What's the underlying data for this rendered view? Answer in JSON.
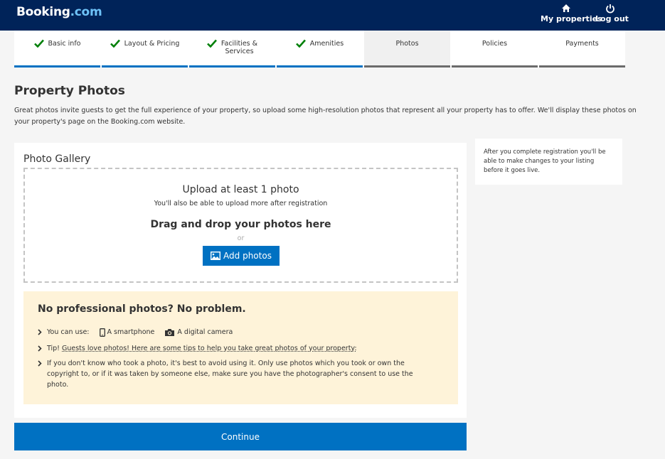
{
  "header": {
    "logo_main": "Booking",
    "logo_suffix": ".com",
    "my_properties": "My properties",
    "log_out": "Log out"
  },
  "steps": [
    {
      "label": "Basic info",
      "done": true
    },
    {
      "label": "Layout & Pricing",
      "done": true
    },
    {
      "label": "Facilities &",
      "label2": "Services",
      "done": true
    },
    {
      "label": "Amenities",
      "done": true
    },
    {
      "label": "Photos",
      "active": true
    },
    {
      "label": "Policies"
    },
    {
      "label": "Payments"
    }
  ],
  "page": {
    "title": "Property Photos",
    "intro": "Great photos invite guests to get the full experience of your property, so upload some high-resolution photos that represent all your property has to offer. We'll display these photos on your property's page on the Booking.com website."
  },
  "gallery": {
    "title": "Photo Gallery",
    "upload_heading": "Upload at least 1 photo",
    "upload_sub": "You'll also be able to upload more after registration",
    "drag_text": "Drag and drop your photos here",
    "or_text": "or",
    "add_button": "Add photos"
  },
  "tips": {
    "title": "No professional photos? No problem.",
    "use_label": "You can use:",
    "device1": "A smartphone",
    "device2": "A digital camera",
    "tip_prefix": "Tip!",
    "tip_link": "Guests love photos! Here are some tips to help you take great photos of your property:",
    "copyright": "If you don't know who took a photo, it's best to avoid using it. Only use photos which you took or own the copyright to, or if it was taken by someone else, make sure you have the photographer's consent to use the photo."
  },
  "continue_label": "Continue",
  "side_note": "After you complete registration you'll be able to make changes to your listing before it goes live.",
  "colors": {
    "header_bg": "#002359",
    "primary": "#0071c2",
    "check_green": "#008009",
    "tips_bg": "#fef3d9"
  }
}
